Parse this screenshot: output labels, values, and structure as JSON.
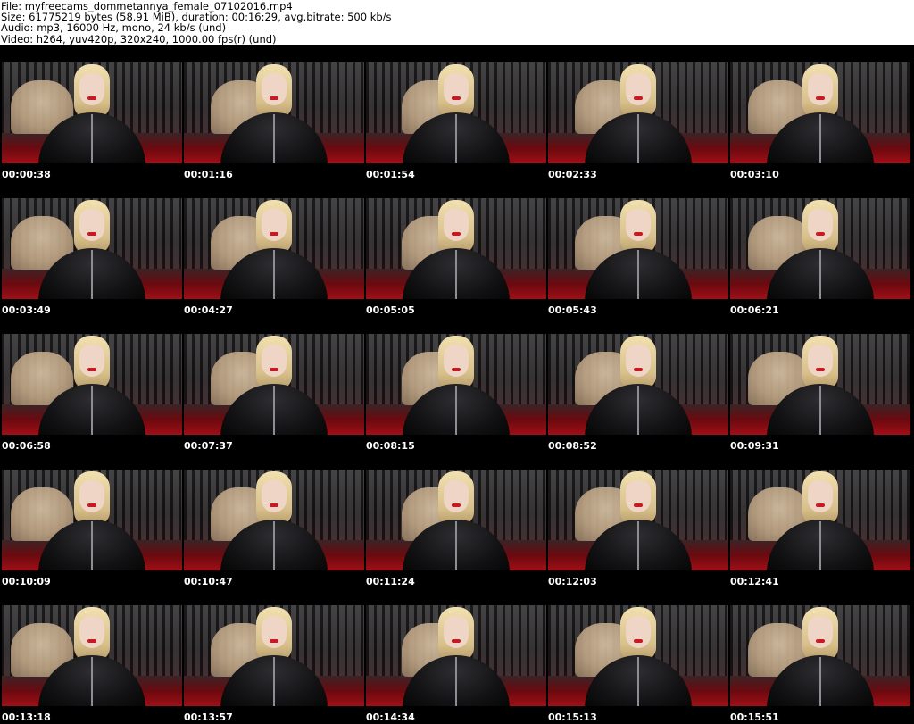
{
  "header": {
    "file": "File: myfreecams_dommetannya_female_07102016.mp4",
    "size": "Size: 61775219 bytes (58.91 MiB), duration: 00:16:29, avg.bitrate: 500 kb/s",
    "audio": "Audio: mp3, 16000 Hz, mono, 24 kb/s (und)",
    "video": "Video: h264, yuv420p, 320x240, 1000.00 fps(r) (und)"
  },
  "timestamps": [
    "00:00:38",
    "00:01:16",
    "00:01:54",
    "00:02:33",
    "00:03:10",
    "00:03:49",
    "00:04:27",
    "00:05:05",
    "00:05:43",
    "00:06:21",
    "00:06:58",
    "00:07:37",
    "00:08:15",
    "00:08:52",
    "00:09:31",
    "00:10:09",
    "00:10:47",
    "00:11:24",
    "00:12:03",
    "00:12:41",
    "00:13:18",
    "00:13:57",
    "00:14:34",
    "00:15:13",
    "00:15:51"
  ]
}
